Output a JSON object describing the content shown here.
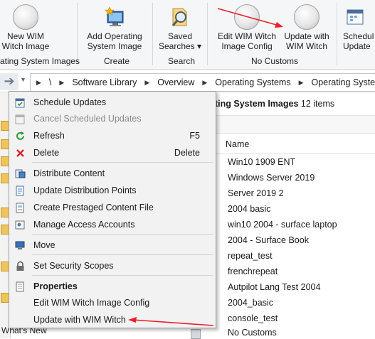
{
  "ribbon": {
    "buttons": [
      {
        "line1": "New WIM",
        "line2": "Witch Image",
        "icon": "circle-icon"
      },
      {
        "line1": "Add Operating",
        "line2": "System Image",
        "icon": "add-image-icon"
      },
      {
        "line1": "Saved",
        "line2": "Searches ▾",
        "icon": "saved-searches-icon"
      },
      {
        "line1": "Edit WIM Witch",
        "line2": "Image Config",
        "icon": "circle-icon"
      },
      {
        "line1": "Update with",
        "line2": "WIM Witch",
        "icon": "circle-icon"
      },
      {
        "line1": "Schedul",
        "line2": "Update",
        "icon": "schedule-icon"
      }
    ],
    "groups": [
      "ating System Images",
      "Create",
      "Search",
      "No Customs"
    ]
  },
  "breadcrumb": {
    "items": [
      "\\",
      "Software Library",
      "Overview",
      "Operating Systems",
      "Operating Syste"
    ]
  },
  "pane": {
    "title_bold": "ting System Images",
    "count": " 12 items",
    "column": "Name",
    "rows": [
      "Win10 1909 ENT",
      "Windows Server 2019",
      "Server 2019 2",
      "2004 basic",
      "win10 2004 - surface laptop",
      "2004 - Surface Book",
      "repeat_test",
      "frenchrepeat",
      "Autpilot Lang Test 2004",
      "2004_basic",
      "console_test",
      "No Customs"
    ]
  },
  "leftnav": {
    "whats_new": "What's New"
  },
  "menu": {
    "items": [
      {
        "label": "Schedule Updates",
        "icon": "schedule-updates-icon"
      },
      {
        "label": "Cancel Scheduled Updates",
        "icon": "cancel-schedule-icon",
        "disabled": true
      },
      {
        "label": "Refresh",
        "shortcut": "F5",
        "icon": "refresh-icon"
      },
      {
        "label": "Delete",
        "shortcut": "Delete",
        "icon": "delete-icon"
      },
      {
        "label": "Distribute Content",
        "icon": "distribute-icon"
      },
      {
        "label": "Update Distribution Points",
        "icon": "update-dp-icon"
      },
      {
        "label": "Create Prestaged Content File",
        "icon": "prestaged-icon"
      },
      {
        "label": "Manage Access Accounts",
        "icon": "access-accounts-icon"
      },
      {
        "label": "Move",
        "icon": "move-icon"
      },
      {
        "label": "Set Security Scopes",
        "icon": "security-scopes-icon"
      },
      {
        "label": "Properties",
        "icon": "properties-icon",
        "bold": true
      },
      {
        "label": "Edit WIM Witch Image Config"
      },
      {
        "label": "Update with WIM Witch"
      }
    ]
  },
  "colors": {
    "annotation_red": "#e8212a",
    "menu_bg": "#f2f2f2",
    "ribbon_bg": "#f5f6f7"
  }
}
